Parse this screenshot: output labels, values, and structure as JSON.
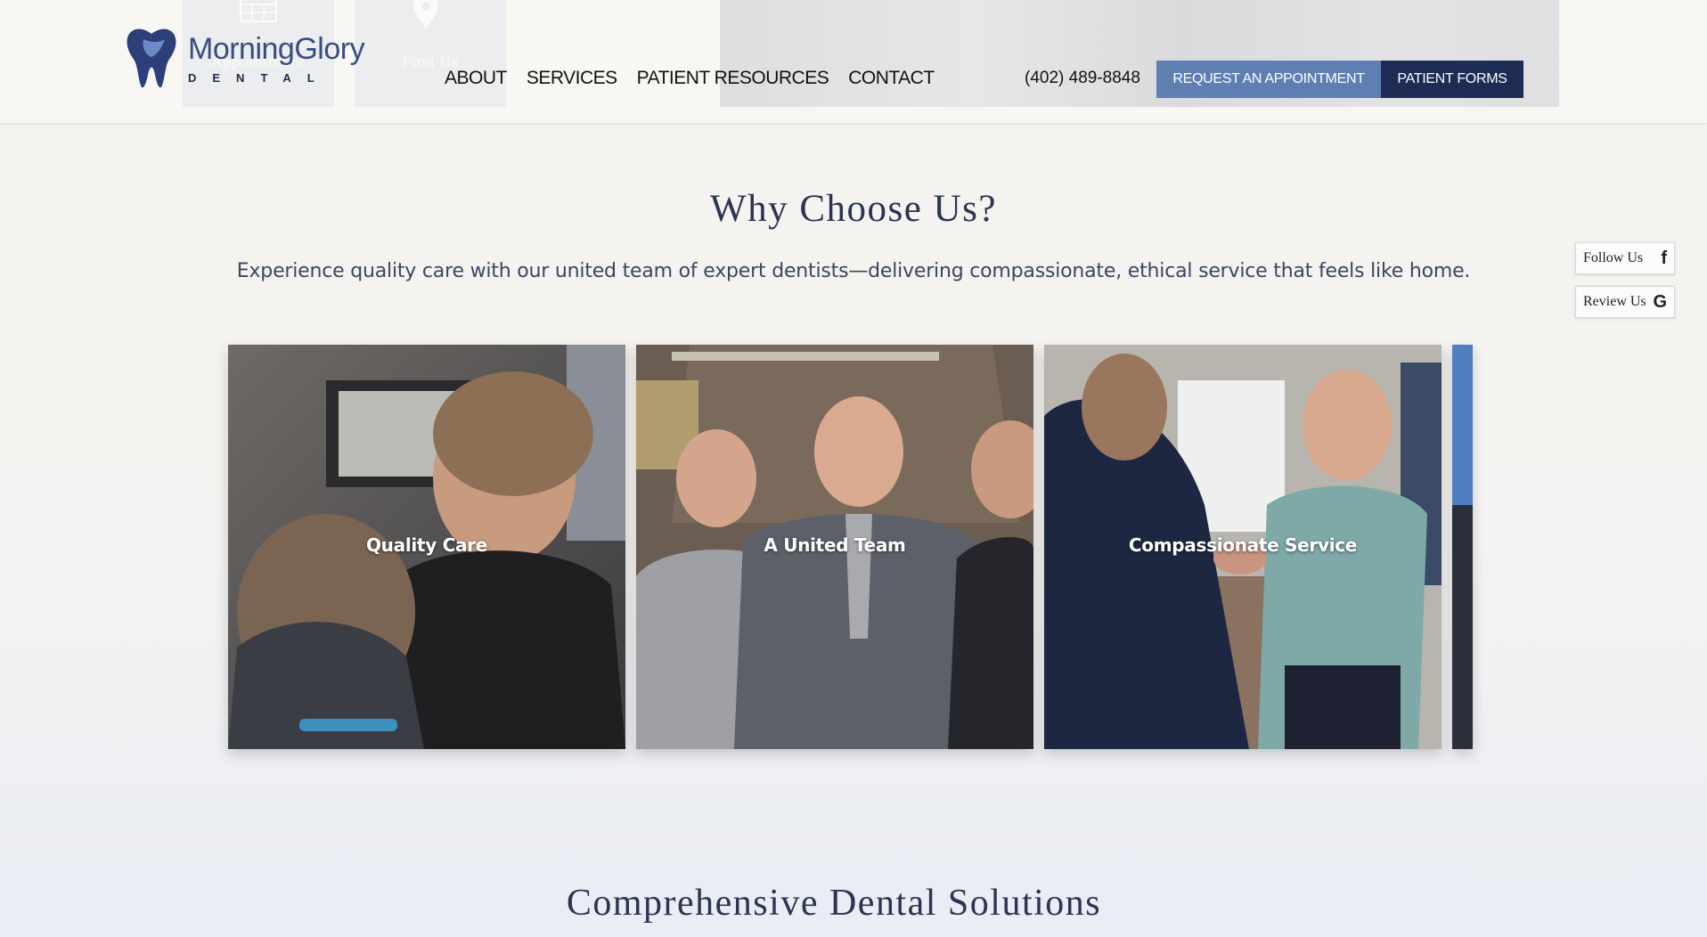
{
  "header": {
    "brand_name": "MorningGlory",
    "brand_sub": "DENTAL",
    "ghost_tiles": [
      "Appointment",
      "Find Us"
    ],
    "nav": [
      {
        "label": "ABOUT"
      },
      {
        "label": "SERVICES"
      },
      {
        "label": "PATIENT RESOURCES"
      },
      {
        "label": "CONTACT"
      }
    ],
    "phone": "(402) 489-8848",
    "appointment_button": "REQUEST AN APPOINTMENT",
    "forms_button": "PATIENT FORMS"
  },
  "why": {
    "title": "Why Choose Us?",
    "subtitle": "Experience quality care with our united team of expert dentists—delivering compassionate, ethical service that feels like home."
  },
  "cards": [
    {
      "caption": "Quality Care"
    },
    {
      "caption": "A United Team"
    },
    {
      "caption": "Compassionate Service"
    }
  ],
  "side": {
    "follow_label": "Follow Us",
    "follow_icon": "f",
    "review_label": "Review Us",
    "review_icon": "G"
  },
  "solutions": {
    "title": "Comprehensive Dental Solutions"
  },
  "colors": {
    "accent": "#5f7fb3",
    "navy": "#1e2c55",
    "heading": "#2b3553"
  }
}
